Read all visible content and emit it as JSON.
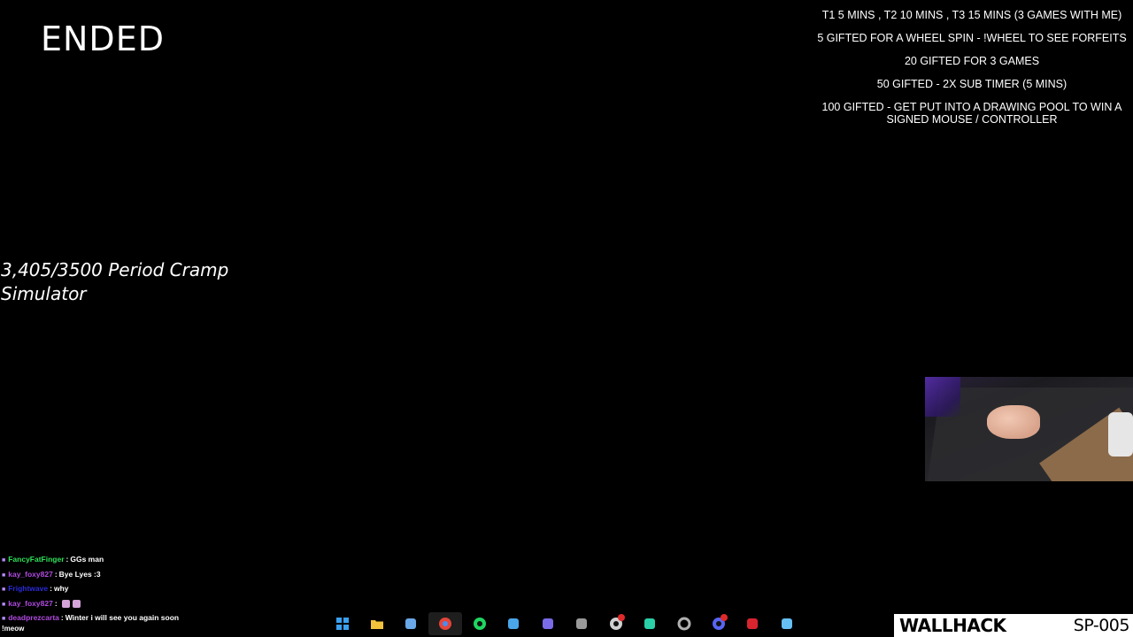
{
  "title": "ENDED",
  "rules": [
    "T1 5 MINS , T2 10 MINS , T3 15 MINS (3 GAMES WITH ME)",
    "5 GIFTED FOR A WHEEL SPIN - !WHEEL TO SEE FORFEITS",
    "20 GIFTED FOR 3 GAMES",
    "50 GIFTED - 2X SUB TIMER (5 MINS)",
    "100 GIFTED - GET PUT INTO A DRAWING POOL TO WIN A SIGNED MOUSE / CONTROLLER"
  ],
  "goal": "3,405/3500 Period Cramp Simulator",
  "chat": [
    {
      "user": "FancyFatFinger",
      "color": "#2ee05a",
      "text": "GGs man",
      "emotes": 0
    },
    {
      "user": "kay_foxy827",
      "color": "#b04ae0",
      "text": "Bye Lyes :3",
      "emotes": 0
    },
    {
      "user": "Frightwave",
      "color": "#2a2ad8",
      "text": "why",
      "emotes": 0
    },
    {
      "user": "kay_foxy827",
      "color": "#b04ae0",
      "text": "",
      "emotes": 2
    },
    {
      "user": "deadprezcarta",
      "color": "#b04ae0",
      "text": "Winter i will see you again soon",
      "emotes": 0
    }
  ],
  "chat_command": "!meow",
  "taskbar": [
    {
      "name": "windows-start-icon",
      "color": "#3aa0f0",
      "active": false,
      "badge": false
    },
    {
      "name": "file-explorer-icon",
      "color": "#f3c23c",
      "active": false,
      "badge": false
    },
    {
      "name": "task-view-icon",
      "color": "#6aa8e8",
      "active": false,
      "badge": false
    },
    {
      "name": "chrome-icon",
      "color": "#e3453a",
      "active": true,
      "badge": false
    },
    {
      "name": "spotify-icon",
      "color": "#1ed760",
      "active": false,
      "badge": false
    },
    {
      "name": "notepad-icon",
      "color": "#4aa6e8",
      "active": false,
      "badge": false
    },
    {
      "name": "layers-app-icon",
      "color": "#7a6be8",
      "active": false,
      "badge": false
    },
    {
      "name": "xbox-icon",
      "color": "#9a9a9a",
      "active": false,
      "badge": false
    },
    {
      "name": "obs-icon",
      "color": "#d0d0d0",
      "active": false,
      "badge": true
    },
    {
      "name": "chat-app-icon",
      "color": "#2ad0a8",
      "active": false,
      "badge": false
    },
    {
      "name": "settings-gear-icon",
      "color": "#b0b0b0",
      "active": false,
      "badge": false
    },
    {
      "name": "discord-icon",
      "color": "#5865f2",
      "active": false,
      "badge": true
    },
    {
      "name": "razer-app-icon",
      "color": "#d8242e",
      "active": false,
      "badge": false
    },
    {
      "name": "steam-icon",
      "color": "#66c0f4",
      "active": false,
      "badge": false
    }
  ],
  "watermark": {
    "brand": "WALLHACK",
    "model": "SP-005"
  }
}
